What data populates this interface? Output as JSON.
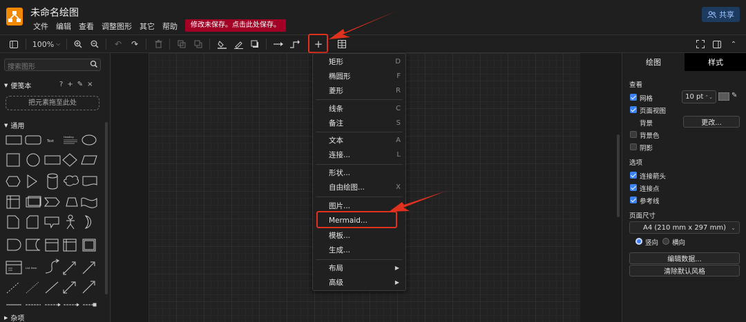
{
  "header": {
    "title": "未命名绘图",
    "menus": [
      "文件",
      "编辑",
      "查看",
      "调整图形",
      "其它",
      "帮助"
    ],
    "unsaved_notice": "修改未保存。点击此处保存。",
    "share_label": "共享"
  },
  "toolbar": {
    "zoom": "100%"
  },
  "left": {
    "search_placeholder": "搜索图形",
    "scratchpad_label": "便笺本",
    "dropzone_text": "把元素拖至此处",
    "general_label": "通用",
    "misc_label": "杂项",
    "shape_text": "Text",
    "shape_heading": "Heading",
    "shape_list_item": "List Item"
  },
  "dropdown": {
    "items": [
      {
        "label": "矩形",
        "shortcut": "D"
      },
      {
        "label": "椭圆形",
        "shortcut": "F"
      },
      {
        "label": "菱形",
        "shortcut": "R"
      },
      {
        "label": "线条",
        "shortcut": "C"
      },
      {
        "label": "备注",
        "shortcut": "S"
      },
      {
        "label": "文本",
        "shortcut": "A"
      },
      {
        "label": "连接...",
        "shortcut": "L"
      },
      {
        "label": "形状...",
        "shortcut": ""
      },
      {
        "label": "自由绘图...",
        "shortcut": "X"
      },
      {
        "label": "图片...",
        "shortcut": ""
      },
      {
        "label": "Mermaid...",
        "shortcut": ""
      },
      {
        "label": "模板...",
        "shortcut": ""
      },
      {
        "label": "生成...",
        "shortcut": ""
      },
      {
        "label": "布局",
        "shortcut": ""
      },
      {
        "label": "高级",
        "shortcut": ""
      }
    ]
  },
  "right": {
    "tab_draw": "绘图",
    "tab_style": "样式",
    "view_label": "查看",
    "grid_label": "网格",
    "grid_size": "10 pt",
    "page_view_label": "页面视图",
    "background_label": "背景",
    "change_button": "更改...",
    "bg_color_label": "背景色",
    "shadow_label": "阴影",
    "options_label": "选项",
    "connection_arrows_label": "连接箭头",
    "connection_points_label": "连接点",
    "guides_label": "参考线",
    "page_size_label": "页面尺寸",
    "page_size_value": "A4 (210 mm x 297 mm)",
    "portrait_label": "竖向",
    "landscape_label": "横向",
    "edit_data_button": "编辑数据...",
    "clear_style_button": "清除默认风格"
  },
  "colors": {
    "accent": "#3b82f6",
    "logo": "#f08705",
    "unsaved_bg": "#a20025",
    "annotation": "#e0301e"
  }
}
